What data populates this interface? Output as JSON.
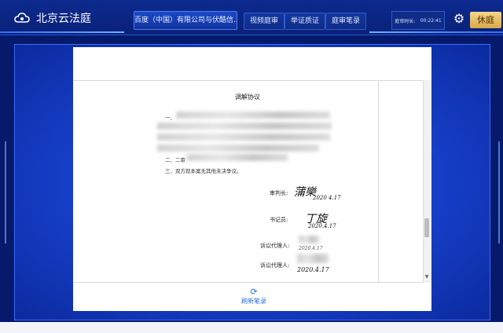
{
  "header": {
    "app_title": "北京云法庭",
    "case_tab": "百度（中国）有限公司与伏酷信...",
    "nav": [
      "视频庭审",
      "举证质证",
      "庭审笔录"
    ],
    "timer_label": "庭审时长:",
    "timer_value": "00:22:41",
    "recess_label": "休庭"
  },
  "document": {
    "title": "调解协议",
    "item1_prefix": "一、",
    "item2_prefix": "二、二审",
    "item3": "三、双方就本案无其他未决争议。",
    "signatures": [
      {
        "label": "审判长:",
        "sig_name": "蒲樂",
        "sig_date": "2020 4.17"
      },
      {
        "label": "书记员:",
        "sig_name": "丁旋",
        "sig_date": "2020.4.17"
      },
      {
        "label": "诉讼代理人:",
        "sig_name": "",
        "sig_date": "2020.4.17"
      },
      {
        "label": "诉讼代理人:",
        "sig_name": "",
        "sig_date": "2020.4.17"
      }
    ]
  },
  "footer": {
    "refresh_label": "刷新笔录"
  },
  "colors": {
    "frame": "#1a45d6",
    "header_bg": "#0a2178",
    "recess_button": "#e0b458",
    "refresh_text": "#2c6fe0"
  }
}
